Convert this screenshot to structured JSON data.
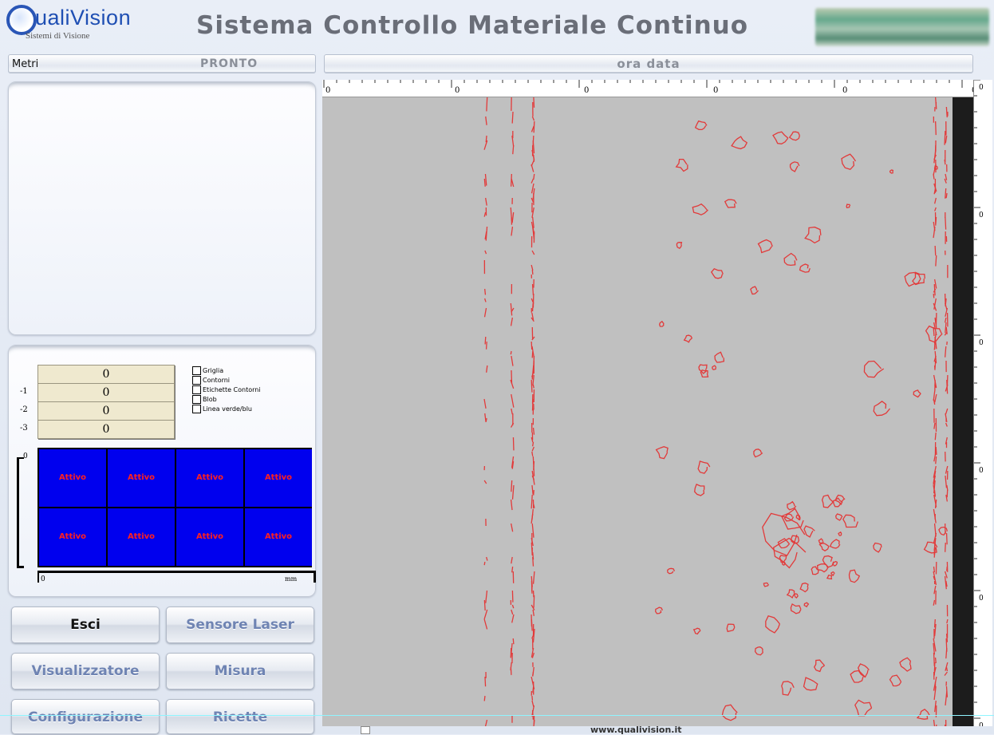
{
  "header": {
    "logo_brand": "ualiVision",
    "logo_tagline": "Sistemi di Visione",
    "title": "Sistema Controllo Materiale Continuo"
  },
  "status": {
    "meter_label": "Metri",
    "state": "PRONTO",
    "datetime": "ora data"
  },
  "counters": [
    {
      "label": "",
      "value": "0"
    },
    {
      "label": "-1",
      "value": "0"
    },
    {
      "label": "-2",
      "value": "0"
    },
    {
      "label": "-3",
      "value": "0"
    }
  ],
  "display_options": [
    {
      "label": "Griglia",
      "checked": false
    },
    {
      "label": "Contorni",
      "checked": false
    },
    {
      "label": "Etichette Contorni",
      "checked": false
    },
    {
      "label": "Blob",
      "checked": false
    },
    {
      "label": "Linea verde/blu",
      "checked": false
    }
  ],
  "sensor_grid": {
    "cells": [
      "Attivo",
      "Attivo",
      "Attivo",
      "Attivo",
      "Attivo",
      "Attivo",
      "Attivo",
      "Attivo"
    ],
    "v_axis_start": "0",
    "h_axis_start": "0",
    "h_axis_unit": "mm",
    "cell_color": "#0000ee",
    "text_color": "#ff2020"
  },
  "buttons": {
    "exit": "Esci",
    "laser_sensor": "Sensore Laser",
    "viewer": "Visualizzatore",
    "measure": "Misura",
    "configuration": "Configurazione",
    "recipes": "Ricette"
  },
  "viewer": {
    "ruler_ticks": [
      "0",
      "0",
      "0",
      "0",
      "0",
      "0"
    ],
    "vruler_ticks": [
      "0",
      "0",
      "0",
      "0",
      "0",
      "0"
    ],
    "background": "#c0c0c0",
    "contour_color": "#e23a3a"
  },
  "footer": {
    "url": "www.qualivision.it"
  }
}
